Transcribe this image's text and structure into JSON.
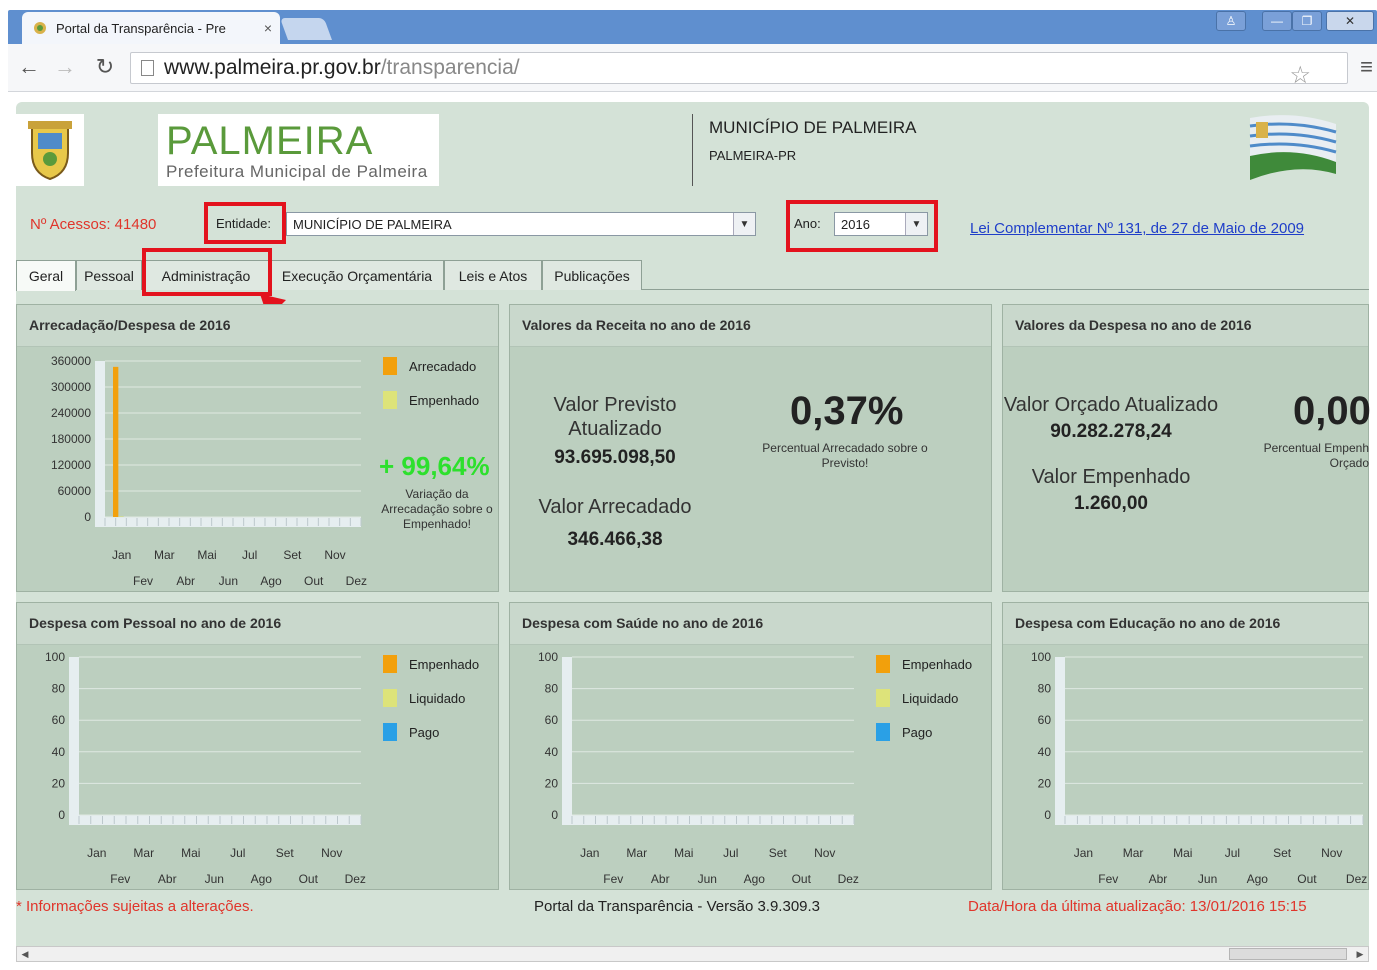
{
  "browser": {
    "tab_title": "Portal da Transparência - Pre",
    "tab_close": "×",
    "url_host": "www.palmeira.pr.gov.br",
    "url_path": "/transparencia/",
    "icons": [
      "back-icon",
      "forward-icon",
      "reload-icon",
      "star-icon",
      "menu-icon"
    ]
  },
  "header": {
    "logo_title": "PALMEIRA",
    "logo_subtitle": "Prefeitura Municipal de Palmeira",
    "municipality": "MUNICÍPIO DE PALMEIRA",
    "municipality_sub": "PALMEIRA-PR"
  },
  "filters": {
    "acessos": "Nº Acessos: 41480",
    "entidade_label": "Entidade:",
    "entidade_value": "MUNICÍPIO DE PALMEIRA",
    "ano_label": "Ano:",
    "ano_value": "2016",
    "law_link": "Lei Complementar Nº 131, de 27 de Maio de 2009"
  },
  "tabs": [
    "Geral",
    "Pessoal",
    "Administração",
    "Execução Orçamentária",
    "Leis e Atos",
    "Publicações"
  ],
  "colors": {
    "highlight": "#e3121d",
    "arrecadado": "#f2a00c",
    "empenhado_light": "#dde37a",
    "pago": "#2aa0e6",
    "variation": "#2de02d"
  },
  "panels": {
    "arrecadacao": {
      "title": "Arrecadação/Despesa de 2016",
      "legend": [
        "Arrecadado",
        "Empenhado"
      ],
      "variation": "+ 99,64%",
      "variation_caption": "Variação da Arrecadação sobre o Empenhado!"
    },
    "receita": {
      "title": "Valores da Receita no ano de 2016",
      "previsto_label": "Valor Previsto Atualizado",
      "previsto_value": "93.695.098,50",
      "arrecadado_label": "Valor Arrecadado",
      "arrecadado_value": "346.466,38",
      "percent": "0,37%",
      "percent_caption": "Percentual Arrecadado sobre o Previsto!"
    },
    "despesa": {
      "title": "Valores da Despesa no ano de 2016",
      "orcado_label": "Valor Orçado Atualizado",
      "orcado_value": "90.282.278,24",
      "empenhado_label": "Valor Empenhado",
      "empenhado_value": "1.260,00",
      "percent": "0,00",
      "percent_caption": "Percentual Empenh Orçado"
    },
    "pessoal": {
      "title": "Despesa com Pessoal no ano de 2016",
      "legend": [
        "Empenhado",
        "Liquidado",
        "Pago"
      ]
    },
    "saude": {
      "title": "Despesa com Saúde no ano de 2016",
      "legend": [
        "Empenhado",
        "Liquidado",
        "Pago"
      ]
    },
    "educacao": {
      "title": "Despesa com Educação no ano de 2016"
    }
  },
  "chart_data": [
    {
      "type": "bar",
      "title": "Arrecadação/Despesa de 2016",
      "categories": [
        "Jan",
        "Fev",
        "Mar",
        "Abr",
        "Mai",
        "Jun",
        "Jul",
        "Ago",
        "Set",
        "Out",
        "Nov",
        "Dez"
      ],
      "yticks": [
        "360000",
        "300000",
        "240000",
        "180000",
        "120000",
        "60000",
        "0"
      ],
      "ylim": [
        0,
        360000
      ],
      "series": [
        {
          "name": "Arrecadado",
          "values": [
            346466.38,
            0,
            0,
            0,
            0,
            0,
            0,
            0,
            0,
            0,
            0,
            0
          ]
        },
        {
          "name": "Empenhado",
          "values": [
            1260,
            0,
            0,
            0,
            0,
            0,
            0,
            0,
            0,
            0,
            0,
            0
          ]
        }
      ]
    },
    {
      "type": "bar",
      "title": "Despesa com Pessoal no ano de 2016",
      "categories": [
        "Jan",
        "Fev",
        "Mar",
        "Abr",
        "Mai",
        "Jun",
        "Jul",
        "Ago",
        "Set",
        "Out",
        "Nov",
        "Dez"
      ],
      "yticks": [
        "100",
        "80",
        "60",
        "40",
        "20",
        "0"
      ],
      "ylim": [
        0,
        100
      ],
      "series": [
        {
          "name": "Empenhado",
          "values": [
            0,
            0,
            0,
            0,
            0,
            0,
            0,
            0,
            0,
            0,
            0,
            0
          ]
        },
        {
          "name": "Liquidado",
          "values": [
            0,
            0,
            0,
            0,
            0,
            0,
            0,
            0,
            0,
            0,
            0,
            0
          ]
        },
        {
          "name": "Pago",
          "values": [
            0,
            0,
            0,
            0,
            0,
            0,
            0,
            0,
            0,
            0,
            0,
            0
          ]
        }
      ]
    },
    {
      "type": "bar",
      "title": "Despesa com Saúde no ano de 2016",
      "categories": [
        "Jan",
        "Fev",
        "Mar",
        "Abr",
        "Mai",
        "Jun",
        "Jul",
        "Ago",
        "Set",
        "Out",
        "Nov",
        "Dez"
      ],
      "yticks": [
        "100",
        "80",
        "60",
        "40",
        "20",
        "0"
      ],
      "ylim": [
        0,
        100
      ],
      "series": [
        {
          "name": "Empenhado",
          "values": [
            0,
            0,
            0,
            0,
            0,
            0,
            0,
            0,
            0,
            0,
            0,
            0
          ]
        },
        {
          "name": "Liquidado",
          "values": [
            0,
            0,
            0,
            0,
            0,
            0,
            0,
            0,
            0,
            0,
            0,
            0
          ]
        },
        {
          "name": "Pago",
          "values": [
            0,
            0,
            0,
            0,
            0,
            0,
            0,
            0,
            0,
            0,
            0,
            0
          ]
        }
      ]
    },
    {
      "type": "bar",
      "title": "Despesa com Educação no ano de 2016",
      "categories": [
        "Jan",
        "Fev",
        "Mar",
        "Abr",
        "Mai",
        "Jun",
        "Jul",
        "Ago",
        "Set",
        "Out",
        "Nov",
        "Dez"
      ],
      "yticks": [
        "100",
        "80",
        "60",
        "40",
        "20",
        "0"
      ],
      "ylim": [
        0,
        100
      ],
      "series": [
        {
          "values": [
            0,
            0,
            0,
            0,
            0,
            0,
            0,
            0,
            0,
            0,
            0,
            0
          ]
        }
      ]
    }
  ],
  "footer": {
    "disclaimer": "* Informações sujeitas a alterações.",
    "version": "Portal da Transparência - Versão 3.9.309.3",
    "updated": "Data/Hora da última atualização: 13/01/2016 15:15"
  }
}
